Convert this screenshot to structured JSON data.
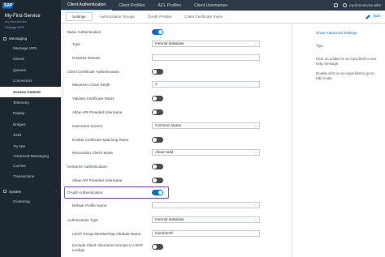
{
  "sidebar": {
    "logo": "SAP",
    "service_name": "My-First-Service",
    "service_sub": "my-first-service",
    "change_vpn": "Change VPN",
    "messaging_section": "Messaging",
    "items": [
      {
        "label": "Message VPN"
      },
      {
        "label": "Clients"
      },
      {
        "label": "Queues"
      },
      {
        "label": "Connectors"
      },
      {
        "label": "Access Control"
      },
      {
        "label": "Telemetry"
      },
      {
        "label": "Replay"
      },
      {
        "label": "Bridges"
      },
      {
        "label": "JNDI"
      },
      {
        "label": "Try Me!"
      }
    ],
    "sub_items": [
      {
        "label": "Advanced Messaging"
      },
      {
        "label": "Caches"
      },
      {
        "label": "Transactions"
      }
    ],
    "system_section": "System",
    "system_items": [
      {
        "label": "Clustering"
      }
    ]
  },
  "topbar": {
    "tabs": [
      {
        "label": "Client Authentication"
      },
      {
        "label": "Client Profiles"
      },
      {
        "label": "ACL Profiles"
      },
      {
        "label": "Client Usernames"
      }
    ],
    "user": "my-first-service-adm"
  },
  "subtabs": [
    {
      "label": "Settings"
    },
    {
      "label": "Authorization Groups"
    },
    {
      "label": "OAuth Profiles"
    },
    {
      "label": "Client Certificate Rules"
    }
  ],
  "edit_label": "Edit",
  "form": {
    "basic_auth": "Basic Authentication",
    "type_label": "Type",
    "type_value": "Internal database",
    "radius_domain": "RADIUS Domain",
    "radius_domain_value": "",
    "client_cert_auth": "Client Certificate Authentication",
    "max_chain_depth": "Maximum Chain Depth",
    "max_chain_depth_value": "3",
    "validate_cert_dates": "Validate Certificate Dates",
    "allow_api_username": "Allow API Provided Username",
    "username_source": "Username Source",
    "username_source_value": "Common Name",
    "enable_cert_rules": "Enable Certificate Matching Rules",
    "revocation_check": "Revocation Check Mode",
    "revocation_check_value": "Allow Valid",
    "kerberos_auth": "Kerberos Authentication",
    "kerberos_allow_api": "Allow API Provided Username",
    "oauth_auth": "OAuth Authentication",
    "default_profile_name": "Default Profile Name",
    "default_profile_value": "",
    "authz_type": "Authorization Type",
    "authz_type_value": "Internal database",
    "ldap_group_attr": "LDAP Group Membership Attribute Name",
    "ldap_group_attr_value": "memberOf",
    "exclude_domain_line1": "Exclude Client Username Domain in LDAP",
    "exclude_domain_line2": "Lookup"
  },
  "sidepanel": {
    "show_advanced": "Show Advanced Settings",
    "tips_title": "Tips",
    "tip1": "Click on a label or an input field to see help message.",
    "tip2": "Double click on an input field to go to Edit mode."
  },
  "toggles": {
    "basic_auth": true,
    "client_cert_auth": false,
    "validate_cert_dates": false,
    "allow_api_username": false,
    "enable_cert_rules": false,
    "kerberos_auth": false,
    "kerberos_allow_api": false,
    "oauth_auth": true,
    "exclude_domain": false
  },
  "colors": {
    "accent": "#0a6ed1",
    "sidebar_bg": "#1d2730",
    "highlight_border": "#7b4bd8"
  }
}
